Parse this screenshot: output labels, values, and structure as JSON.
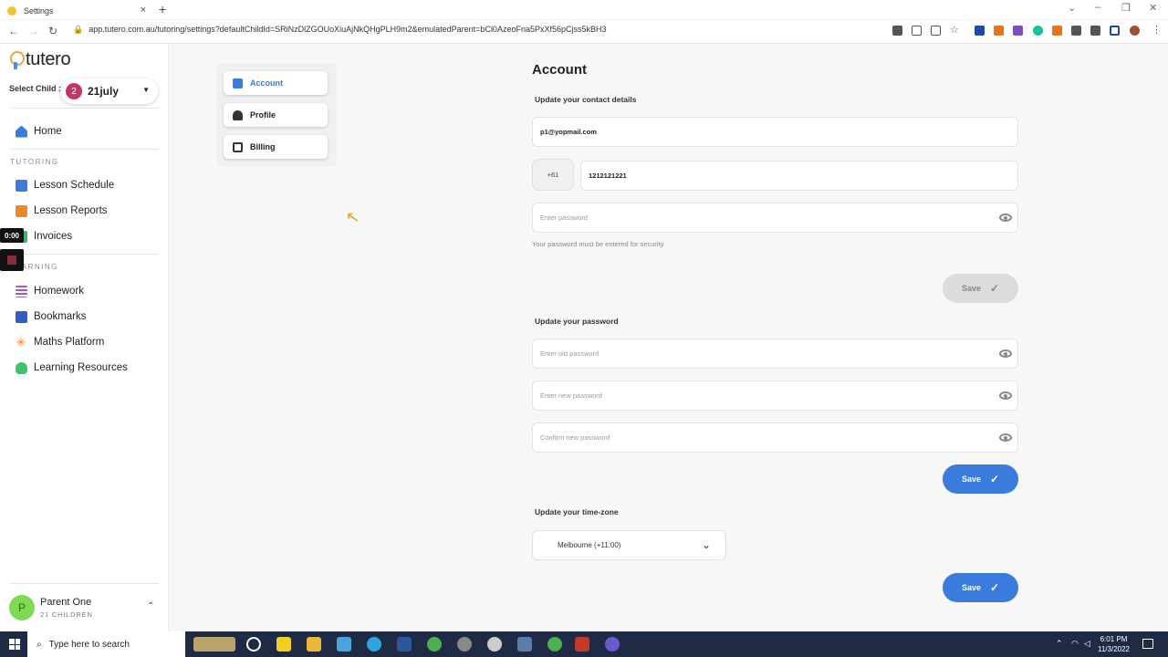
{
  "browser": {
    "tab_title": "Settings",
    "tab_close": "×",
    "new_tab": "+",
    "url": "app.tutero.com.au/tutoring/settings?defaultChildId=SRiNzDlZGOUoXiuAjNkQHgPLH9m2&emulatedParent=bCl0AzeoFna5PxXf56pCjss5kBH3",
    "window_controls": [
      "⌄",
      "–",
      "❐",
      "✕"
    ]
  },
  "sidebar": {
    "logo_text": "tutero",
    "select_child_label": "Select Child :",
    "child_badge": "2",
    "child_name": "21july",
    "home": "Home",
    "tutoring_section": "TUTORING",
    "tutoring_items": [
      "Lesson Schedule",
      "Lesson Reports",
      "Invoices"
    ],
    "learning_section": "LEARNING",
    "learning_items": [
      "Homework",
      "Bookmarks",
      "Maths Platform",
      "Learning Resources"
    ],
    "user_initial": "P",
    "user_name": "Parent One",
    "user_children": "21 CHILDREN"
  },
  "recorder": {
    "time": "0:00"
  },
  "settings_tabs": [
    "Account",
    "Profile",
    "Billing"
  ],
  "account": {
    "title": "Account",
    "contact_heading": "Update your contact details",
    "email": "p1@yopmail.com",
    "country_code": "+61",
    "phone": "1212121221",
    "password_placeholder": "Enter password",
    "password_hint": "Your password must be entered for security.",
    "save_label": "Save",
    "password_heading": "Update your password",
    "old_password_placeholder": "Enter old password",
    "new_password_placeholder": "Enter new password",
    "confirm_password_placeholder": "Confirm new password",
    "timezone_heading": "Update your time-zone",
    "timezone_value": "Melbourne (+11:00)"
  },
  "taskbar": {
    "search_placeholder": "Type here to search",
    "time": "6:01 PM",
    "date": "11/3/2022"
  },
  "colors": {
    "accent": "#3a7bdc",
    "badge": "#c0366a",
    "avatar": "#7ed957",
    "taskbar": "#1f2a44"
  }
}
